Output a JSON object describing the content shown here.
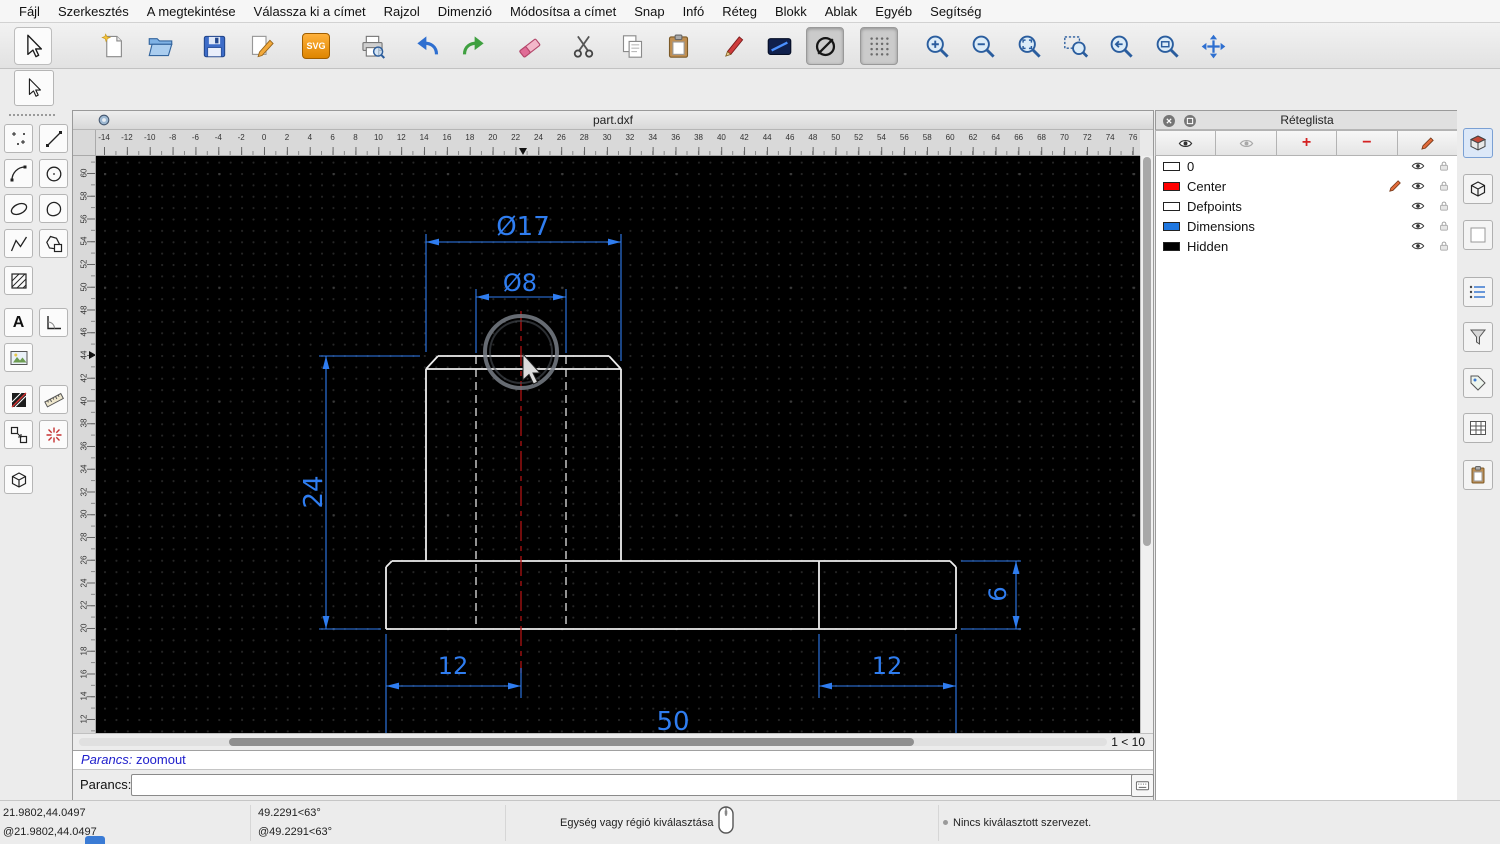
{
  "menu_bar": {
    "items": [
      "Fájl",
      "Szerkesztés",
      "A megtekintése",
      "Válassza ki a címet",
      "Rajzol",
      "Dimenzió",
      "Módosítsa a címet",
      "Snap",
      "Infó",
      "Réteg",
      "Blokk",
      "Ablak",
      "Egyéb",
      "Segítség"
    ]
  },
  "window": {
    "title": "part.dxf",
    "page_indicator": "1 < 10"
  },
  "rulers": {
    "horizontal": [
      "-14",
      "-12",
      "-10",
      "-8",
      "-6",
      "-4",
      "-2",
      "0",
      "2",
      "4",
      "6",
      "8",
      "10",
      "12",
      "14",
      "16",
      "18",
      "20",
      "22",
      "24",
      "26",
      "28",
      "30",
      "32",
      "34",
      "36",
      "38",
      "40",
      "42",
      "44",
      "46",
      "48",
      "50",
      "52",
      "54",
      "56",
      "58",
      "60",
      "62",
      "64",
      "66",
      "68",
      "70",
      "72",
      "74",
      "76"
    ],
    "vertical": [
      "60",
      "58",
      "56",
      "54",
      "52",
      "50",
      "48",
      "46",
      "44",
      "42",
      "40",
      "38",
      "36",
      "34",
      "32",
      "30",
      "28",
      "26",
      "24",
      "22",
      "20",
      "18",
      "16",
      "14",
      "12"
    ]
  },
  "drawing": {
    "dim_diameter_outer": "Ø17",
    "dim_diameter_inner": "Ø8",
    "dim_height": "24",
    "dim_flange_height": "6",
    "dim_left_offset": "12",
    "dim_right_offset": "12",
    "dim_total_width": "50",
    "dimension_color": "#2f7df0",
    "outline_color": "#ededed",
    "centerline_color": "#b11212"
  },
  "layer_panel": {
    "title": "Réteglista",
    "layers": [
      {
        "name": "0",
        "color": "#ffffff",
        "editing": false
      },
      {
        "name": "Center",
        "color": "#ff0000",
        "editing": true
      },
      {
        "name": "Defpoints",
        "color": "#ffffff",
        "editing": false
      },
      {
        "name": "Dimensions",
        "color": "#1f77e0",
        "editing": false
      },
      {
        "name": "Hidden",
        "color": "#000000",
        "editing": false
      }
    ]
  },
  "command": {
    "history_label": "Parancs:",
    "history_entry": "zoomout",
    "prompt_label": "Parancs:",
    "input_value": ""
  },
  "status_bar": {
    "absolute_coords": "21.9802,44.0497",
    "relative_coords": "@21.9802,44.0497",
    "absolute_polar": "49.2291<63°",
    "relative_polar": "@49.2291<63°",
    "hint": "Egység vagy régió kiválasztása",
    "selection_status": "Nincs kiválasztott szervezet."
  },
  "glyphs": {
    "svg_badge": "SVG",
    "text_tool": "A",
    "layer_add": "+",
    "layer_remove": "−"
  }
}
